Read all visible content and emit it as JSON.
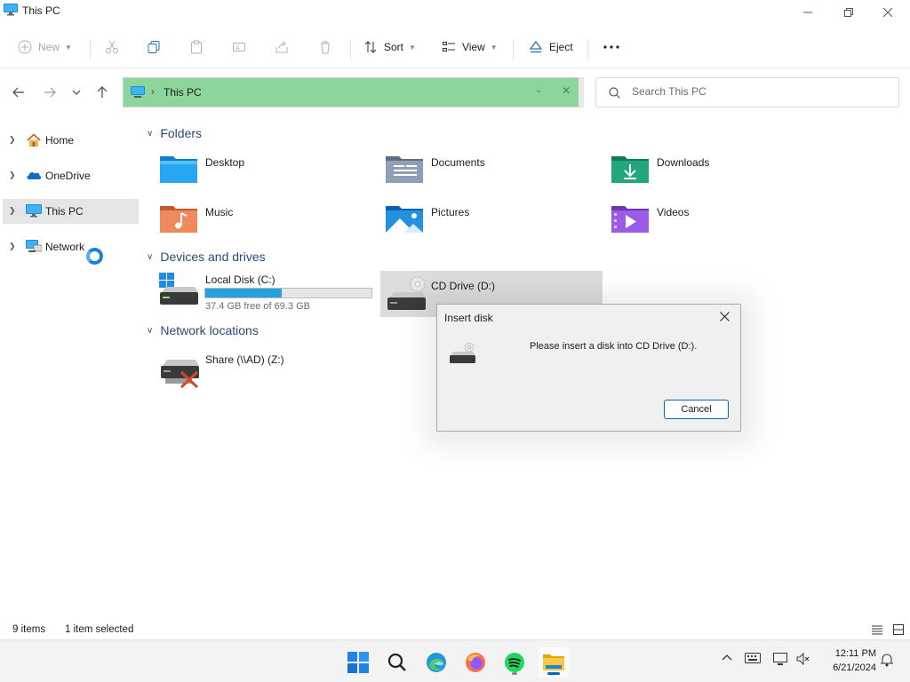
{
  "window": {
    "title": "This PC"
  },
  "commandbar": {
    "new_label": "New",
    "sort_label": "Sort",
    "view_label": "View",
    "eject_label": "Eject",
    "more_label": "..."
  },
  "address": {
    "path_label": "This PC"
  },
  "search": {
    "placeholder": "Search This PC"
  },
  "sidebar": {
    "items": [
      {
        "label": "Home",
        "icon": "home-icon"
      },
      {
        "label": "OneDrive",
        "icon": "onedrive-icon"
      },
      {
        "label": "This PC",
        "icon": "pc-icon",
        "selected": true
      },
      {
        "label": "Network",
        "icon": "network-icon"
      }
    ]
  },
  "sections": {
    "folders": {
      "title": "Folders",
      "items": [
        {
          "label": "Desktop",
          "icon": "desktop-folder-icon"
        },
        {
          "label": "Documents",
          "icon": "documents-folder-icon"
        },
        {
          "label": "Downloads",
          "icon": "downloads-folder-icon"
        },
        {
          "label": "Music",
          "icon": "music-folder-icon"
        },
        {
          "label": "Pictures",
          "icon": "pictures-folder-icon"
        },
        {
          "label": "Videos",
          "icon": "videos-folder-icon"
        }
      ]
    },
    "devices": {
      "title": "Devices and drives",
      "items": [
        {
          "label": "Local Disk (C:)",
          "free_text": "37.4 GB free of 69.3 GB",
          "used_fraction": 0.46
        },
        {
          "label": "CD Drive (D:)",
          "selected": true
        }
      ]
    },
    "network": {
      "title": "Network locations",
      "items": [
        {
          "label": "Share (\\\\AD) (Z:)"
        }
      ]
    }
  },
  "statusbar": {
    "item_count": "9 items",
    "selection": "1 item selected"
  },
  "dialog": {
    "title": "Insert disk",
    "message": "Please insert a disk into CD Drive (D:).",
    "cancel_label": "Cancel"
  },
  "taskbar": {
    "apps": [
      "start-icon",
      "search-icon",
      "edge-icon",
      "firefox-icon",
      "spotify-icon",
      "file-explorer-icon"
    ],
    "time": "12:11 PM",
    "date": "6/21/2024"
  },
  "colors": {
    "accent": "#0067c0",
    "address_highlight": "#8cd69b",
    "disk_bar": "#26a0da",
    "selected_bg": "#e5e5e5"
  }
}
